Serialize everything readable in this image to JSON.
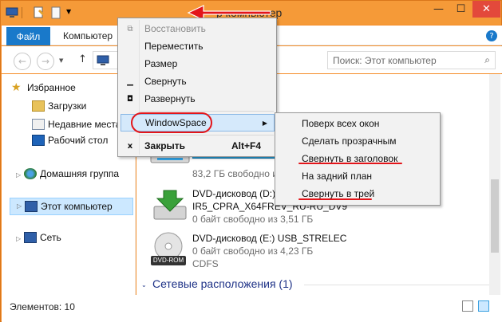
{
  "window": {
    "title": "Этот компьютер",
    "title_visible": "р компьютер",
    "controls": {
      "minimize": "—",
      "maximize": "☐",
      "close": "✕"
    }
  },
  "ribbon": {
    "tabs": [
      {
        "label": "Файл"
      },
      {
        "label": "Компьютер"
      }
    ]
  },
  "address": {
    "search_placeholder": "Поиск: Этот компьютер"
  },
  "nav_pane": {
    "favorites": "Избранное",
    "downloads": "Загрузки",
    "recent": "Недавние места",
    "desktop": "Рабочий стол",
    "homegroup": "Домашняя группа",
    "this_pc": "Этот компьютер",
    "network": "Сеть"
  },
  "content": {
    "drive1_free": "83,2 ГБ свободно из",
    "dvd1_name": "DVD-дисковод (D:)",
    "dvd1_label": "IR5_CPRA_X64FREV_RU-RU_DV9",
    "dvd1_free": "0 байт свободно из 3,51 ГБ",
    "dvd2_name": "DVD-дисковод (E:) USB_STRELEC",
    "dvd2_free": "0 байт свободно из 4,23 ГБ",
    "dvd2_fs": "CDFS",
    "dvd_rom_badge": "DVD-ROM",
    "network_group": "Сетевые расположения (1)"
  },
  "status": {
    "items": "Элементов: 10"
  },
  "context_menu": {
    "items": [
      {
        "label": "Восстановить",
        "disabled": true
      },
      {
        "label": "Переместить"
      },
      {
        "label": "Размер"
      },
      {
        "label": "Свернуть"
      },
      {
        "label": "Развернуть"
      },
      {
        "label": "WindowSpace"
      },
      {
        "label": "Закрыть",
        "shortcut": "Alt+F4"
      }
    ]
  },
  "submenu": {
    "items": [
      {
        "label": "Поверх всех окон"
      },
      {
        "label": "Сделать прозрачным"
      },
      {
        "label": "Свернуть в заголовок"
      },
      {
        "label": "На задний план"
      },
      {
        "label": "Свернуть в трей"
      }
    ]
  },
  "colors": {
    "accent": "#1979ca",
    "title_bar": "#f59a38",
    "highlight_red": "#e3151a"
  }
}
